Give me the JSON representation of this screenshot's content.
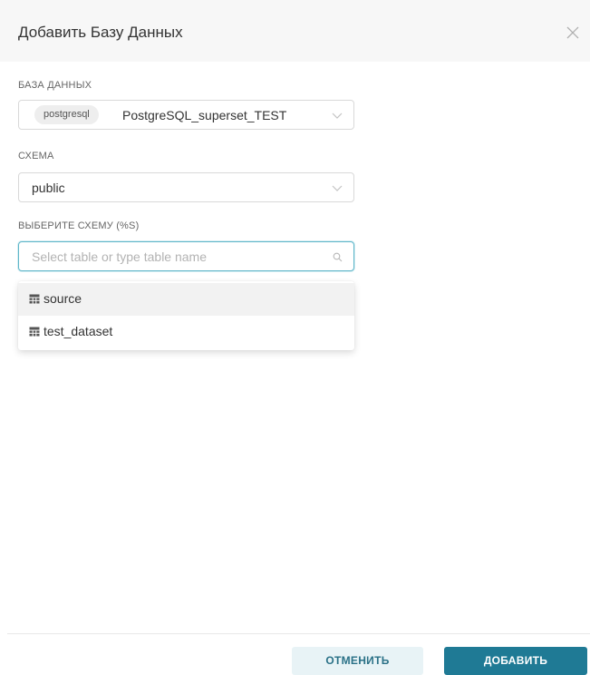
{
  "modal": {
    "title": "Добавить Базу Данных"
  },
  "database": {
    "label": "БАЗА ДАННЫХ",
    "tag": "postgresql",
    "value": "PostgreSQL_superset_TEST"
  },
  "schema": {
    "label": "СХЕМА",
    "value": "public"
  },
  "table": {
    "label": "ВЫБЕРИТЕ СХЕМУ (%S)",
    "placeholder": "Select table or type table name",
    "options": [
      {
        "label": "source",
        "highlighted": true
      },
      {
        "label": "test_dataset",
        "highlighted": false
      }
    ]
  },
  "footer": {
    "cancel_label": "ОТМЕНИТЬ",
    "add_label": "ДОБАВИТЬ"
  },
  "colors": {
    "primary": "#1f7a95",
    "primary_light": "#e8f3f6",
    "focus_border": "#5fb6c9"
  }
}
